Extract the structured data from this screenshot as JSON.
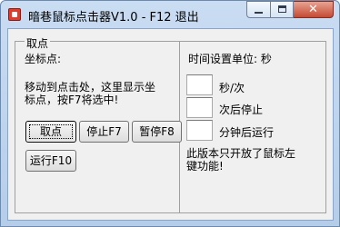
{
  "window": {
    "title": "暗巷鼠标点击器V1.0 - F12 退出",
    "close_glyph": "✕"
  },
  "pick_group": {
    "caption": "取点",
    "coord_label": "坐标点:",
    "instruction": "移动到点击处，这里显示坐标点，按F7将选中!"
  },
  "buttons": {
    "pick": "取点",
    "stop": "停止F7",
    "pause": "暂停F8",
    "run": "运行F10"
  },
  "time_settings": {
    "unit_label": "时间设置单位: 秒",
    "interval_value": "",
    "interval_label": "秒/次",
    "stop_after_value": "",
    "stop_after_label": "次后停止",
    "delay_value": "",
    "delay_label": "分钟后运行",
    "note": "此版本只开放了鼠标左键功能!"
  }
}
